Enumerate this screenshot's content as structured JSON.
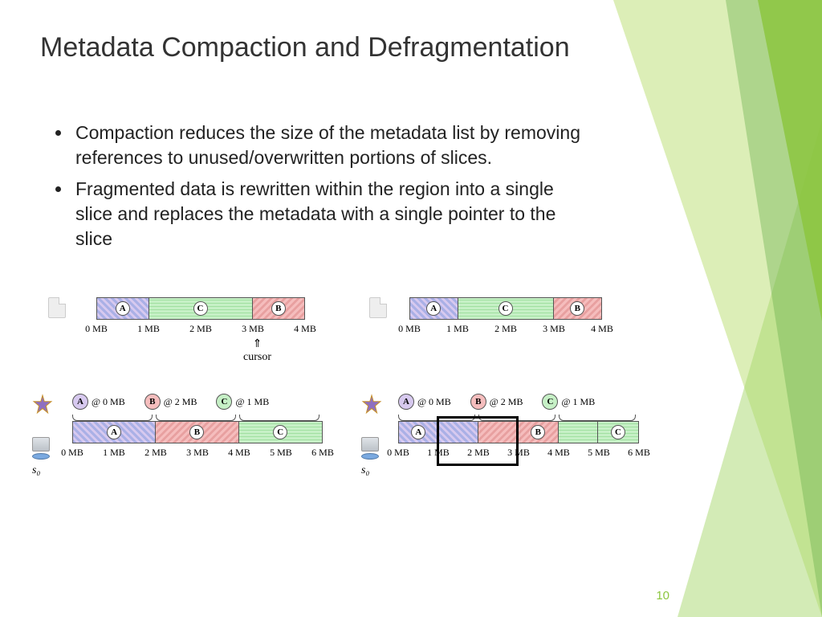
{
  "title": "Metadata Compaction and Defragmentation",
  "bullets": [
    "Compaction reduces the size of the metadata list by removing references to unused/overwritten portions of slices.",
    "Fragmented data is rewritten within the region into a single  slice and replaces the metadata with a single pointer to the slice"
  ],
  "pageNumber": "10",
  "diagrams": {
    "topLeft": {
      "blocks": [
        {
          "label": "A",
          "color": "purple",
          "span": 1
        },
        {
          "label": "C",
          "color": "green",
          "span": 2
        },
        {
          "label": "B",
          "color": "red",
          "span": 1
        }
      ],
      "ticks": [
        "0 MB",
        "1 MB",
        "2 MB",
        "3 MB",
        "4 MB"
      ],
      "cursor": "cursor",
      "cursorAt": "3 MB"
    },
    "topRight": {
      "blocks": [
        {
          "label": "A",
          "color": "purple",
          "span": 1
        },
        {
          "label": "C",
          "color": "green",
          "span": 2
        },
        {
          "label": "B",
          "color": "red",
          "span": 1
        }
      ],
      "ticks": [
        "0 MB",
        "1 MB",
        "2 MB",
        "3 MB",
        "4 MB"
      ]
    },
    "bottomLeft": {
      "server": "s₀",
      "pointers": [
        {
          "label": "A",
          "offset": "@ 0 MB"
        },
        {
          "label": "B",
          "offset": "@ 2 MB"
        },
        {
          "label": "C",
          "offset": "@ 1 MB"
        }
      ],
      "blocks": [
        {
          "label": "A",
          "color": "purple",
          "span": 2
        },
        {
          "label": "B",
          "color": "red",
          "span": 2
        },
        {
          "label": "C",
          "color": "green",
          "span": 2
        }
      ],
      "ticks": [
        "0 MB",
        "1 MB",
        "2 MB",
        "3 MB",
        "4 MB",
        "5 MB",
        "6 MB"
      ]
    },
    "bottomRight": {
      "server": "s₀",
      "pointers": [
        {
          "label": "A",
          "offset": "@ 0 MB"
        },
        {
          "label": "B",
          "offset": "@ 2 MB"
        },
        {
          "label": "C",
          "offset": "@ 1 MB"
        }
      ],
      "blocks": [
        {
          "label": "A",
          "color": "purple"
        },
        {
          "label": "B",
          "color": "red"
        },
        {
          "label": "C",
          "color": "green"
        }
      ],
      "ticks": [
        "0 MB",
        "1 MB",
        "2 MB",
        "3 MB",
        "4 MB",
        "5 MB",
        "6 MB"
      ],
      "highlightRange": [
        "1 MB",
        "3 MB"
      ]
    }
  }
}
